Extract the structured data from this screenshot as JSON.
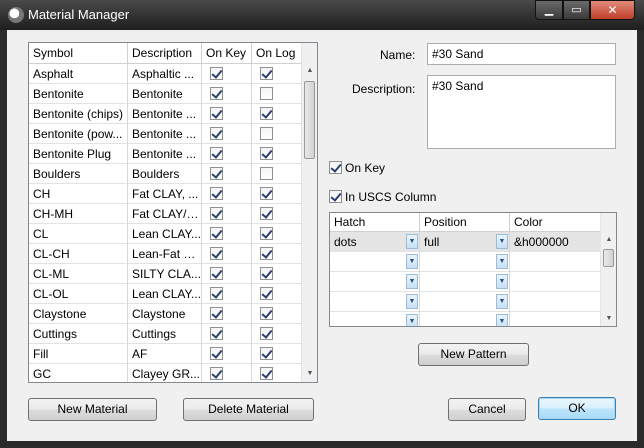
{
  "window": {
    "title": "Material Manager",
    "controls": {
      "minimize": "▁",
      "maximize": "▭",
      "close": "✕"
    }
  },
  "materials": {
    "columns": [
      "Symbol",
      "Description",
      "On Key",
      "On Log"
    ],
    "rows": [
      {
        "symbol": "Asphalt",
        "description": "Asphaltic ...",
        "on_key": true,
        "on_log": true
      },
      {
        "symbol": "Bentonite",
        "description": "Bentonite",
        "on_key": true,
        "on_log": false
      },
      {
        "symbol": "Bentonite (chips)",
        "description": "Bentonite ...",
        "on_key": true,
        "on_log": true
      },
      {
        "symbol": "Bentonite (pow...",
        "description": "Bentonite ...",
        "on_key": true,
        "on_log": false
      },
      {
        "symbol": "Bentonite Plug",
        "description": "Bentonite ...",
        "on_key": true,
        "on_log": true
      },
      {
        "symbol": "Boulders",
        "description": "Boulders",
        "on_key": true,
        "on_log": false
      },
      {
        "symbol": "CH",
        "description": "Fat CLAY, ...",
        "on_key": true,
        "on_log": true
      },
      {
        "symbol": "CH-MH",
        "description": "Fat CLAY/S...",
        "on_key": true,
        "on_log": true
      },
      {
        "symbol": "CL",
        "description": "Lean CLAY...",
        "on_key": true,
        "on_log": true
      },
      {
        "symbol": "CL-CH",
        "description": "Lean-Fat C...",
        "on_key": true,
        "on_log": true
      },
      {
        "symbol": "CL-ML",
        "description": "SILTY CLA...",
        "on_key": true,
        "on_log": true
      },
      {
        "symbol": "CL-OL",
        "description": "Lean CLAY...",
        "on_key": true,
        "on_log": true
      },
      {
        "symbol": "Claystone",
        "description": "Claystone",
        "on_key": true,
        "on_log": true
      },
      {
        "symbol": "Cuttings",
        "description": "Cuttings",
        "on_key": true,
        "on_log": true
      },
      {
        "symbol": "Fill",
        "description": "AF",
        "on_key": true,
        "on_log": true
      },
      {
        "symbol": "GC",
        "description": "Clayey GR...",
        "on_key": true,
        "on_log": true
      }
    ],
    "scroll_up": "▲",
    "scroll_down": "▼"
  },
  "buttons": {
    "new_material": "New Material",
    "delete_material": "Delete Material",
    "new_pattern": "New Pattern",
    "cancel": "Cancel",
    "ok": "OK"
  },
  "form": {
    "name_label": "Name:",
    "name_value": "#30 Sand",
    "description_label": "Description:",
    "description_value": "#30 Sand",
    "on_key_label": "On Key",
    "on_key_checked": true,
    "uscs_label": "In USCS Column",
    "uscs_checked": true
  },
  "patterns": {
    "columns": [
      "Hatch",
      "Position",
      "Color"
    ],
    "rows": [
      {
        "hatch": "dots",
        "position": "full",
        "color": "&h000000"
      },
      {
        "hatch": "",
        "position": "",
        "color": ""
      },
      {
        "hatch": "",
        "position": "",
        "color": ""
      },
      {
        "hatch": "",
        "position": "",
        "color": ""
      },
      {
        "hatch": "",
        "position": "",
        "color": ""
      }
    ],
    "dropdown_glyph": "▼"
  }
}
